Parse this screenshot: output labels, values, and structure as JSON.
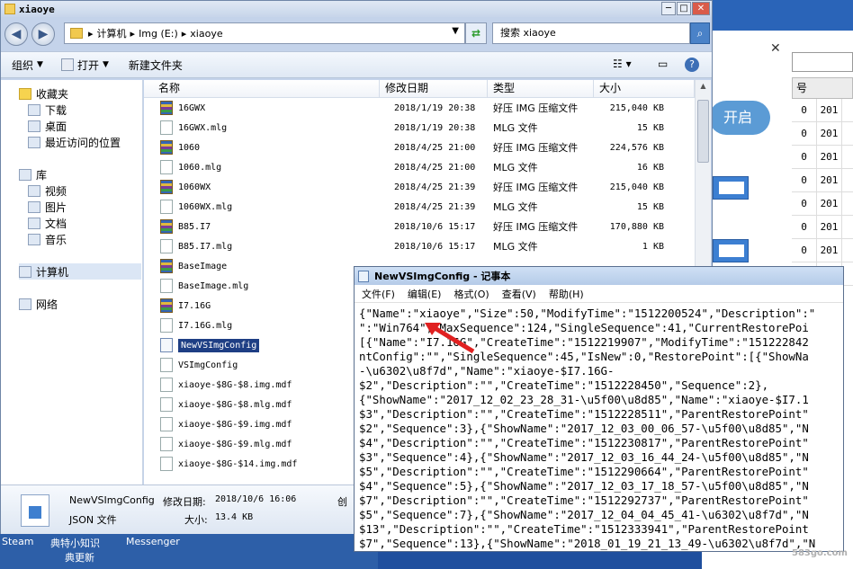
{
  "explorer": {
    "title": "xiaoye",
    "breadcrumb": [
      "计算机",
      "Img (E:)",
      "xiaoye"
    ],
    "search_placeholder": "搜索 xiaoye",
    "toolbar": {
      "organize": "组织",
      "open": "打开",
      "new_folder": "新建文件夹"
    },
    "nav": {
      "favorites": "收藏夹",
      "downloads": "下载",
      "desktop": "桌面",
      "recent": "最近访问的位置",
      "libraries": "库",
      "videos": "视频",
      "pictures": "图片",
      "documents": "文档",
      "music": "音乐",
      "computer": "计算机",
      "network": "网络"
    },
    "columns": {
      "name": "名称",
      "modified": "修改日期",
      "type": "类型",
      "size": "大小"
    },
    "files": [
      {
        "name": "16GWX",
        "date": "2018/1/19 20:38",
        "type": "好压 IMG 压缩文件",
        "size": "215,040 KB",
        "icon": "archive-icon"
      },
      {
        "name": "16GWX.mlg",
        "date": "2018/1/19 20:38",
        "type": "MLG 文件",
        "size": "15 KB",
        "icon": "file-icon"
      },
      {
        "name": "1060",
        "date": "2018/4/25 21:00",
        "type": "好压 IMG 压缩文件",
        "size": "224,576 KB",
        "icon": "archive-icon"
      },
      {
        "name": "1060.mlg",
        "date": "2018/4/25 21:00",
        "type": "MLG 文件",
        "size": "16 KB",
        "icon": "file-icon"
      },
      {
        "name": "1060WX",
        "date": "2018/4/25 21:39",
        "type": "好压 IMG 压缩文件",
        "size": "215,040 KB",
        "icon": "archive-icon"
      },
      {
        "name": "1060WX.mlg",
        "date": "2018/4/25 21:39",
        "type": "MLG 文件",
        "size": "15 KB",
        "icon": "file-icon"
      },
      {
        "name": "B85.I7",
        "date": "2018/10/6 15:17",
        "type": "好压 IMG 压缩文件",
        "size": "170,880 KB",
        "icon": "archive-icon"
      },
      {
        "name": "B85.I7.mlg",
        "date": "2018/10/6 15:17",
        "type": "MLG 文件",
        "size": "1 KB",
        "icon": "file-icon"
      },
      {
        "name": "BaseImage",
        "date": "",
        "type": "",
        "size": "",
        "icon": "archive-icon"
      },
      {
        "name": "BaseImage.mlg",
        "date": "",
        "type": "",
        "size": "",
        "icon": "file-icon"
      },
      {
        "name": "I7.16G",
        "date": "",
        "type": "",
        "size": "",
        "icon": "archive-icon"
      },
      {
        "name": "I7.16G.mlg",
        "date": "",
        "type": "",
        "size": "",
        "icon": "file-icon"
      },
      {
        "name": "NewVSImgConfig",
        "date": "",
        "type": "",
        "size": "",
        "icon": "json-icon",
        "selected": true
      },
      {
        "name": "VSImgConfig",
        "date": "",
        "type": "",
        "size": "",
        "icon": "config-icon"
      },
      {
        "name": "xiaoye-$8G-$8.img.mdf",
        "date": "",
        "type": "",
        "size": "",
        "icon": "file-icon"
      },
      {
        "name": "xiaoye-$8G-$8.mlg.mdf",
        "date": "",
        "type": "",
        "size": "",
        "icon": "file-icon"
      },
      {
        "name": "xiaoye-$8G-$9.img.mdf",
        "date": "",
        "type": "",
        "size": "",
        "icon": "file-icon"
      },
      {
        "name": "xiaoye-$8G-$9.mlg.mdf",
        "date": "",
        "type": "",
        "size": "",
        "icon": "file-icon"
      },
      {
        "name": "xiaoye-$8G-$14.img.mdf",
        "date": "",
        "type": "",
        "size": "",
        "icon": "file-icon"
      }
    ],
    "details": {
      "name": "NewVSImgConfig",
      "modified_label": "修改日期:",
      "modified": "2018/10/6 16:06",
      "type": "JSON 文件",
      "size_label": "大小:",
      "size": "13.4 KB",
      "truncated": "创"
    }
  },
  "notepad": {
    "title": "NewVSImgConfig - 记事本",
    "menu": [
      "文件(F)",
      "编辑(E)",
      "格式(O)",
      "查看(V)",
      "帮助(H)"
    ],
    "lines": [
      "{\"Name\":\"xiaoye\",\"Size\":50,\"ModifyTime\":\"1512200524\",\"Description\":\"",
      "\":\"Win764\",\"MaxSequence\":124,\"SingleSequence\":41,\"CurrentRestorePoi",
      "[{\"Name\":\"I7.16G\",\"CreateTime\":\"1512219907\",\"ModifyTime\":\"151222842",
      "ntConfig\":\"\",\"SingleSequence\":45,\"IsNew\":0,\"RestorePoint\":[{\"ShowNa",
      "-\\u6302\\u8f7d\",\"Name\":\"xiaoye-$I7.16G-",
      "$2\",\"Description\":\"\",\"CreateTime\":\"1512228450\",\"Sequence\":2},",
      "{\"ShowName\":\"2017_12_02_23_28_31-\\u5f00\\u8d85\",\"Name\":\"xiaoye-$I7.1",
      "$3\",\"Description\":\"\",\"CreateTime\":\"1512228511\",\"ParentRestorePoint\"",
      "$2\",\"Sequence\":3},{\"ShowName\":\"2017_12_03_00_06_57-\\u5f00\\u8d85\",\"N",
      "$4\",\"Description\":\"\",\"CreateTime\":\"1512230817\",\"ParentRestorePoint\"",
      "$3\",\"Sequence\":4},{\"ShowName\":\"2017_12_03_16_44_24-\\u5f00\\u8d85\",\"N",
      "$5\",\"Description\":\"\",\"CreateTime\":\"1512290664\",\"ParentRestorePoint\"",
      "$4\",\"Sequence\":5},{\"ShowName\":\"2017_12_03_17_18_57-\\u5f00\\u8d85\",\"N",
      "$7\",\"Description\":\"\",\"CreateTime\":\"1512292737\",\"ParentRestorePoint\"",
      "$5\",\"Sequence\":7},{\"ShowName\":\"2017_12_04_04_45_41-\\u6302\\u8f7d\",\"N",
      "$13\",\"Description\":\"\",\"CreateTime\":\"1512333941\",\"ParentRestorePoint",
      "$7\",\"Sequence\":13},{\"ShowName\":\"2018_01_19_21_13_49-\\u6302\\u8f7d\",\"N"
    ]
  },
  "background_app": {
    "start_label": "开启",
    "column_header": "号",
    "rows": [
      [
        "0",
        "201"
      ],
      [
        "0",
        "201"
      ],
      [
        "0",
        "201"
      ],
      [
        "0",
        "201"
      ],
      [
        "0",
        "201"
      ],
      [
        "0",
        "201"
      ],
      [
        "0",
        "201"
      ],
      [
        "0",
        ""
      ]
    ]
  },
  "taskbar": {
    "items": [
      "Steam",
      "典特小知识",
      "Messenger"
    ],
    "overlay": "典更新"
  },
  "watermark": "583go.com"
}
